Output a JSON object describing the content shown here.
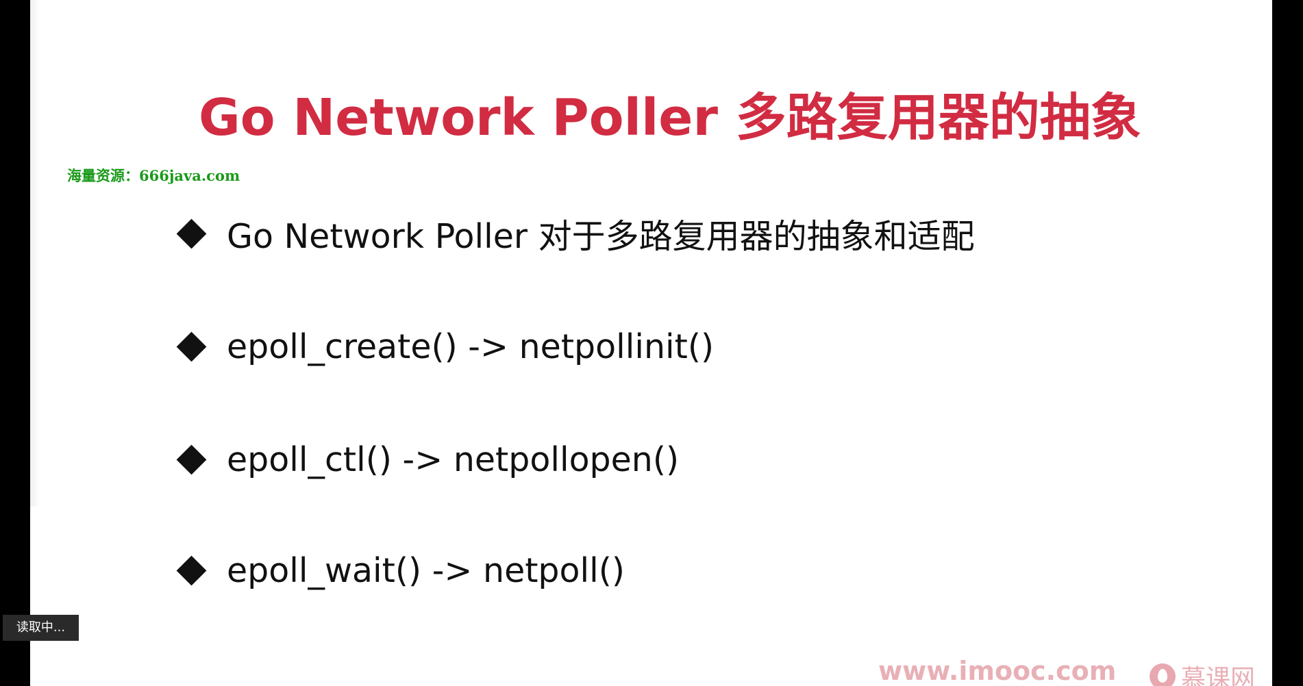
{
  "slide": {
    "title": "Go Network Poller 多路复用器的抽象",
    "watermark": "海量资源：666java.com",
    "bullets": [
      {
        "text": "Go Network Poller 对于多路复用器的抽象和适配"
      },
      {
        "text": "epoll_create() -> netpollinit()"
      },
      {
        "text": "epoll_ctl() -> netpollopen()"
      },
      {
        "text": "epoll_wait() -> netpoll()"
      }
    ],
    "footer_url": "www.imooc.com",
    "footer_brand": "慕课网"
  },
  "player": {
    "status": "读取中..."
  },
  "icons": {
    "bullet_marker": "diamond-icon",
    "brand_logo": "flame-icon"
  },
  "colors": {
    "title": "#d12c42",
    "watermark": "#1b9a1b",
    "body_text": "#111111",
    "footer": "#e8b0b6",
    "background": "#ffffff",
    "frame": "#000000"
  }
}
